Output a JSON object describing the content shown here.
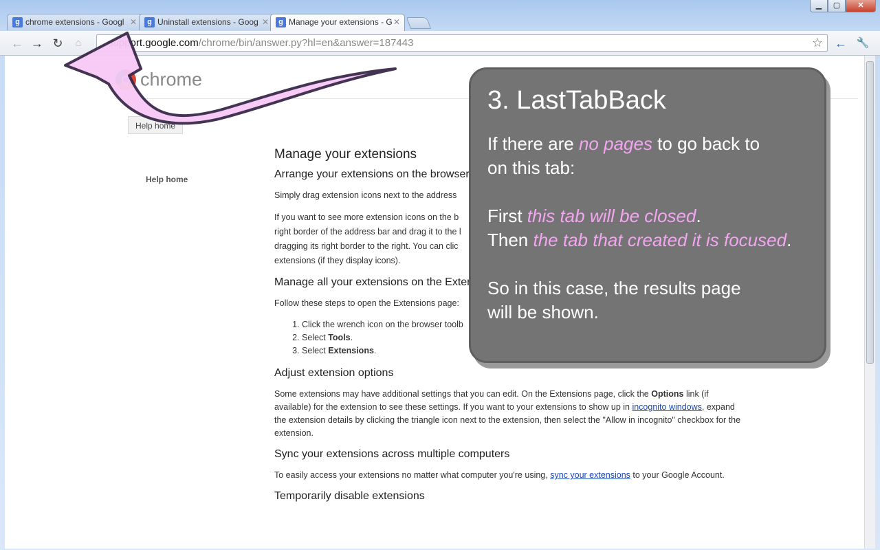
{
  "window": {
    "controls": {
      "minimize": "▁",
      "maximize": "▢",
      "close": "✕"
    }
  },
  "tabs": [
    {
      "title": "chrome extensions - Googl",
      "favicon": "g"
    },
    {
      "title": "Uninstall extensions - Goog",
      "favicon": "g"
    },
    {
      "title": "Manage your extensions - G",
      "favicon": "g",
      "active": true
    }
  ],
  "toolbar": {
    "back_icon": "←",
    "forward_icon": "→",
    "reload_icon": "↻",
    "url_host": "support.google.com",
    "url_path": "/chrome/bin/answer.py?hl=en&answer=187443",
    "star_icon": "☆",
    "ext_icon": "←",
    "wrench_icon": "🔧"
  },
  "page": {
    "logo_text": "chrome",
    "breadcrumb": "Help home",
    "left_nav": "Help home",
    "title": "Manage your extensions",
    "section1_heading": "Arrange your extensions on the browser t",
    "section1_p1": "Simply drag extension icons next to the address",
    "section1_p2a": "If you want to see more extension icons on the b",
    "section1_p2b": "right border of the address bar and drag it to the l",
    "section1_p2c": "dragging its right border to the right. You can clic",
    "section1_p2d": "extensions (if they display icons).",
    "section2_heading": "Manage all your extensions on the Extens",
    "section2_intro": "Follow these steps to open the Extensions page:",
    "steps": [
      {
        "pre": "Click the wrench icon on the browser toolb",
        "bold": ""
      },
      {
        "pre": "Select ",
        "bold": "Tools",
        "post": "."
      },
      {
        "pre": "Select ",
        "bold": "Extensions",
        "post": "."
      }
    ],
    "section3_heading": "Adjust extension options",
    "section3_p_a": "Some extensions may have additional settings that you can edit. On the Extensions page, click the ",
    "section3_p_bold": "Options",
    "section3_p_b": " link (if available) for the extension to see these settings. If you want to your extensions to show up in ",
    "section3_link": "incognito windows",
    "section3_p_c": ", expand the extension details by clicking the triangle icon next to the extension, then select the \"Allow in incognito\" checkbox for the extension.",
    "section4_heading": "Sync your extensions across multiple computers",
    "section4_p_a": "To easily access your extensions no matter what computer you're using, ",
    "section4_link": "sync your extensions",
    "section4_p_b": " to your Google Account.",
    "section5_heading": "Temporarily disable extensions"
  },
  "callout": {
    "title": "3. LastTabBack",
    "l1a": "If there are ",
    "l1em": "no pages",
    "l1b": " to go back to",
    "l2": "on this tab:",
    "l3a": "First ",
    "l3em": "this tab will be closed",
    "l3b": ".",
    "l4a": "Then ",
    "l4em": "the tab that created it is focused",
    "l4b": ".",
    "l5": "So in this case, the results page",
    "l6": "will be shown."
  },
  "colors": {
    "callout_bg": "#747474",
    "highlight": "#f3a6f0",
    "arrow_fill": "#f7c9f5",
    "arrow_stroke": "#3a2a4a"
  }
}
